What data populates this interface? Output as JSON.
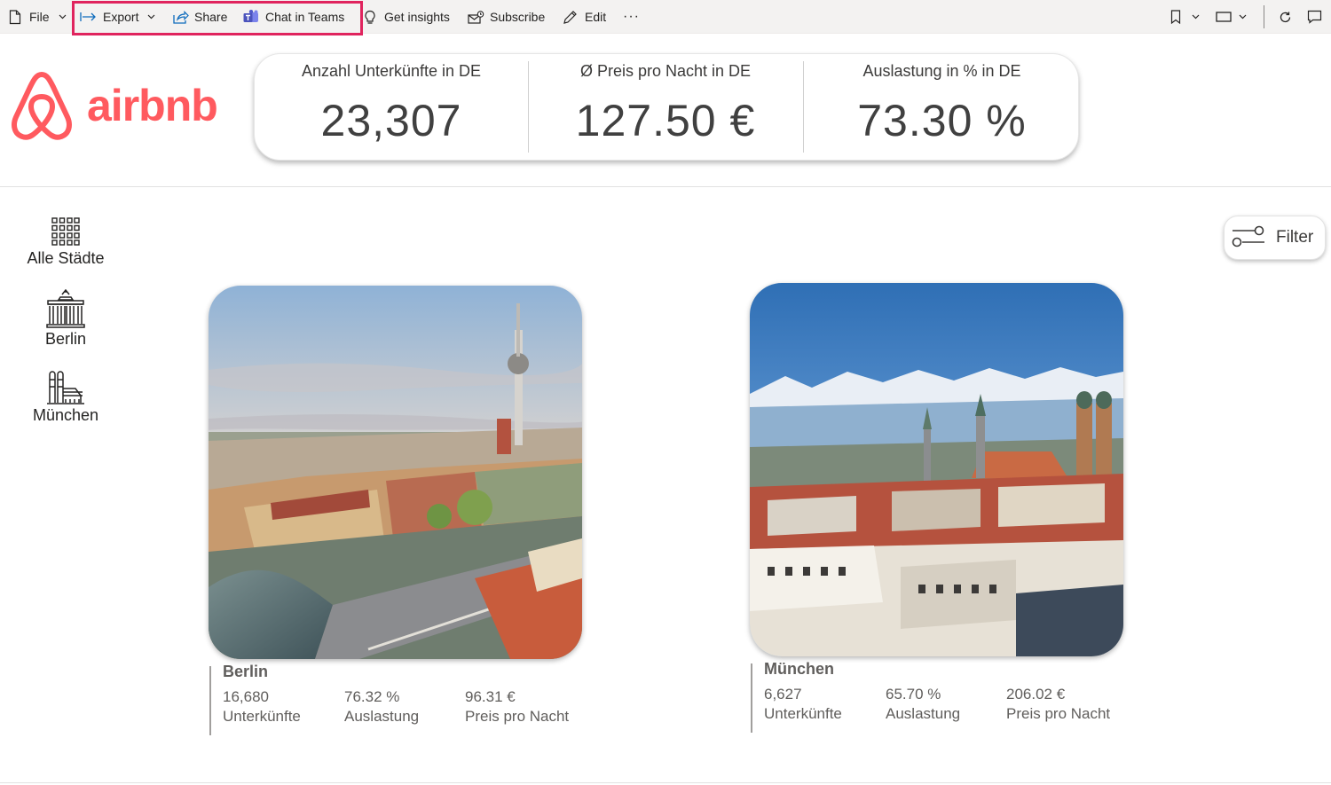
{
  "toolbar": {
    "file": "File",
    "export": "Export",
    "share": "Share",
    "chat_in_teams": "Chat in Teams",
    "get_insights": "Get insights",
    "subscribe": "Subscribe",
    "edit": "Edit",
    "more": "···"
  },
  "logo": {
    "text": "airbnb",
    "color": "#ff5a5f"
  },
  "kpis": [
    {
      "label": "Anzahl Unterkünfte in DE",
      "value": "23,307"
    },
    {
      "label": "Ø Preis pro Nacht in DE",
      "value": "127.50 €"
    },
    {
      "label": "Auslastung in % in DE",
      "value": "73.30 %"
    }
  ],
  "nav": [
    {
      "label": "Alle Städte",
      "icon": "grid-icon"
    },
    {
      "label": "Berlin",
      "icon": "brandenburg-gate-icon"
    },
    {
      "label": "München",
      "icon": "frauenkirche-icon"
    }
  ],
  "filter": {
    "label": "Filter"
  },
  "cities": [
    {
      "name": "Berlin",
      "listings_value": "16,680",
      "listings_label": "Unterkünfte",
      "occupancy_value": "76.32 %",
      "occupancy_label": "Auslastung",
      "price_value": "96.31 €",
      "price_label": "Preis pro Nacht"
    },
    {
      "name": "München",
      "listings_value": "6,627",
      "listings_label": "Unterkünfte",
      "occupancy_value": "65.70 %",
      "occupancy_label": "Auslastung",
      "price_value": "206.02 €",
      "price_label": "Preis pro Nacht"
    }
  ],
  "colors": {
    "highlight": "#e0245e",
    "brand": "#ff5a5f",
    "toolbar_bg": "#f3f2f1"
  }
}
